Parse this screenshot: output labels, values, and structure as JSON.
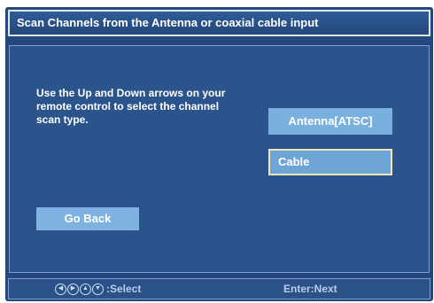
{
  "title": "Scan Channels from the Antenna or coaxial cable input",
  "instructions": "Use the Up and Down arrows on your remote control to select the channel scan type.",
  "options": [
    {
      "label": "Antenna[ATSC]",
      "selected": false
    },
    {
      "label": "Cable",
      "selected": true
    }
  ],
  "back_label": "Go Back",
  "footer": {
    "select_label": ":Select",
    "enter_label": "Enter:Next",
    "icons": [
      "left-arrow-icon",
      "right-arrow-icon",
      "up-arrow-icon",
      "down-arrow-icon"
    ]
  },
  "colors": {
    "background": "#24477d",
    "panel": "#2b548c",
    "button": "#7fb2e0",
    "highlight_border": "#f3e7b6"
  }
}
